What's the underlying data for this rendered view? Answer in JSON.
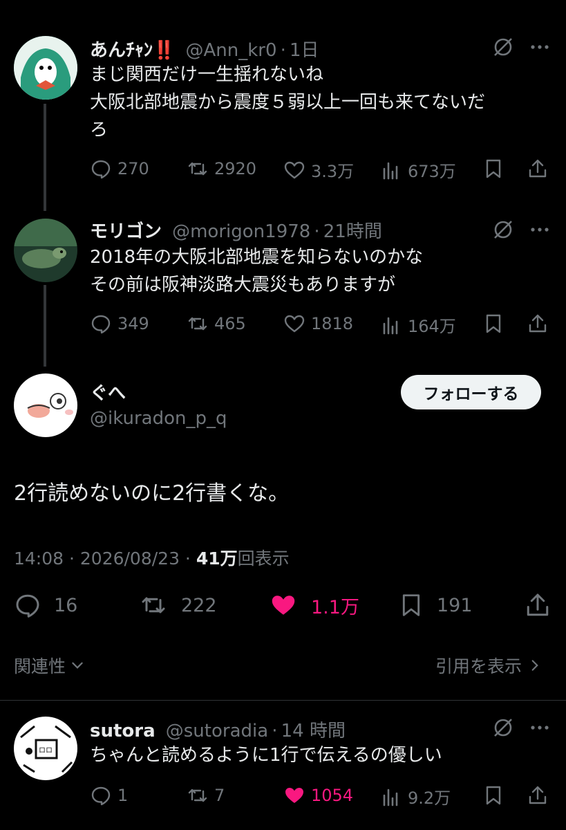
{
  "colors": {
    "bg": "#000000",
    "text": "#e7e9ea",
    "muted": "#71767b",
    "like": "#f91880",
    "button_bg": "#eff3f4"
  },
  "thread": [
    {
      "name": "あんﾁｬﾝ‼️",
      "handle": "@Ann_kr0",
      "time": "1日",
      "text_lines": [
        "まじ関西だけ一生揺れないね",
        "大阪北部地震から震度５弱以上一回も来てないだ",
        "ろ"
      ],
      "stats": {
        "replies": "270",
        "reposts": "2920",
        "likes": "3.3万",
        "views": "673万"
      }
    },
    {
      "name": "モリゴン",
      "handle": "@morigon1978",
      "time": "21時間",
      "text_lines": [
        "2018年の大阪北部地震を知らないのかな",
        "その前は阪神淡路大震災もありますが"
      ],
      "stats": {
        "replies": "349",
        "reposts": "465",
        "likes": "1818",
        "views": "164万"
      }
    }
  ],
  "main": {
    "name": "ぐへ",
    "handle": "@ikuradon_p_q",
    "follow_label": "フォローする",
    "text": "2行読めないのに2行書くな。",
    "timestamp": "14:08 · 2026/08/23 · ",
    "views_count": "41万",
    "views_suffix": "回表示",
    "stats": {
      "replies": "16",
      "reposts": "222",
      "likes": "1.1万",
      "bookmarks": "191"
    },
    "liked": true
  },
  "filters": {
    "relevance_label": "関連性",
    "quotes_label": "引用を表示"
  },
  "reply": {
    "name": "sutora",
    "handle": "@sutoradia",
    "time": "14 時間",
    "text": "ちゃんと読めるように1行で伝えるの優しい",
    "stats": {
      "replies": "1",
      "reposts": "7",
      "likes": "1054",
      "views": "9.2万"
    },
    "liked": true
  },
  "dot_separator": "·"
}
